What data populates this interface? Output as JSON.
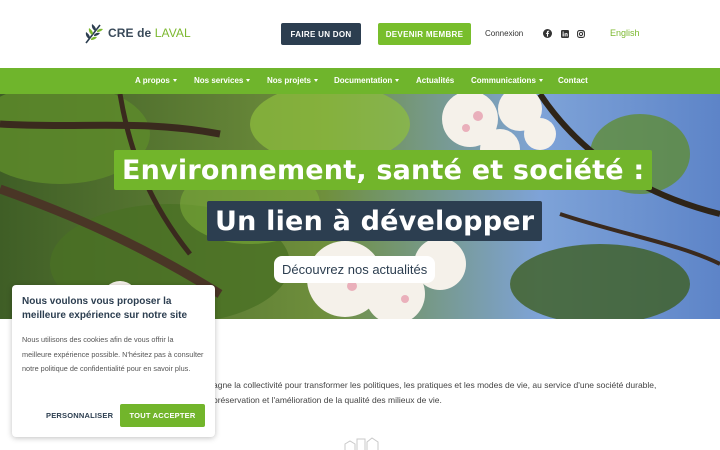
{
  "header": {
    "logo_text_main": "CRE de ",
    "logo_text_accent": "LAVAL",
    "donate_button": "FAIRE UN DON",
    "member_button": "DEVENIR MEMBRE",
    "login_link": "Connexion",
    "language_link": "English",
    "social_icons": [
      "facebook-icon",
      "linkedin-icon",
      "instagram-icon"
    ]
  },
  "nav": {
    "items": [
      {
        "label": "A propos",
        "dropdown": true
      },
      {
        "label": "Nos services",
        "dropdown": true
      },
      {
        "label": "Nos projets",
        "dropdown": true
      },
      {
        "label": "Documentation",
        "dropdown": true
      },
      {
        "label": "Actualités",
        "dropdown": false
      },
      {
        "label": "Communications",
        "dropdown": true
      },
      {
        "label": "Contact",
        "dropdown": false
      }
    ]
  },
  "hero": {
    "title_line1": "Environnement, santé et société :",
    "title_line2": "Un lien à développer",
    "cta": "Découvrez nos actualités"
  },
  "intro": {
    "line1": "agne la collectivité pour transformer les politiques, les pratiques et les modes de vie, au service d'une société durable,",
    "line2": "préservation et l'amélioration de la qualité des milieux de vie."
  },
  "cookie": {
    "title": "Nous voulons vous proposer la meilleure expérience sur notre site",
    "text": "Nous utilisons des cookies afin de vous offrir la meilleure expérience possible. N'hésitez pas à consulter notre politique de confidentialité pour en savoir plus.",
    "customize_button": "PERSONNALISER",
    "accept_button": "TOUT ACCEPTER"
  },
  "colors": {
    "brand_green": "#72b52b",
    "brand_navy": "#2c3e50"
  }
}
